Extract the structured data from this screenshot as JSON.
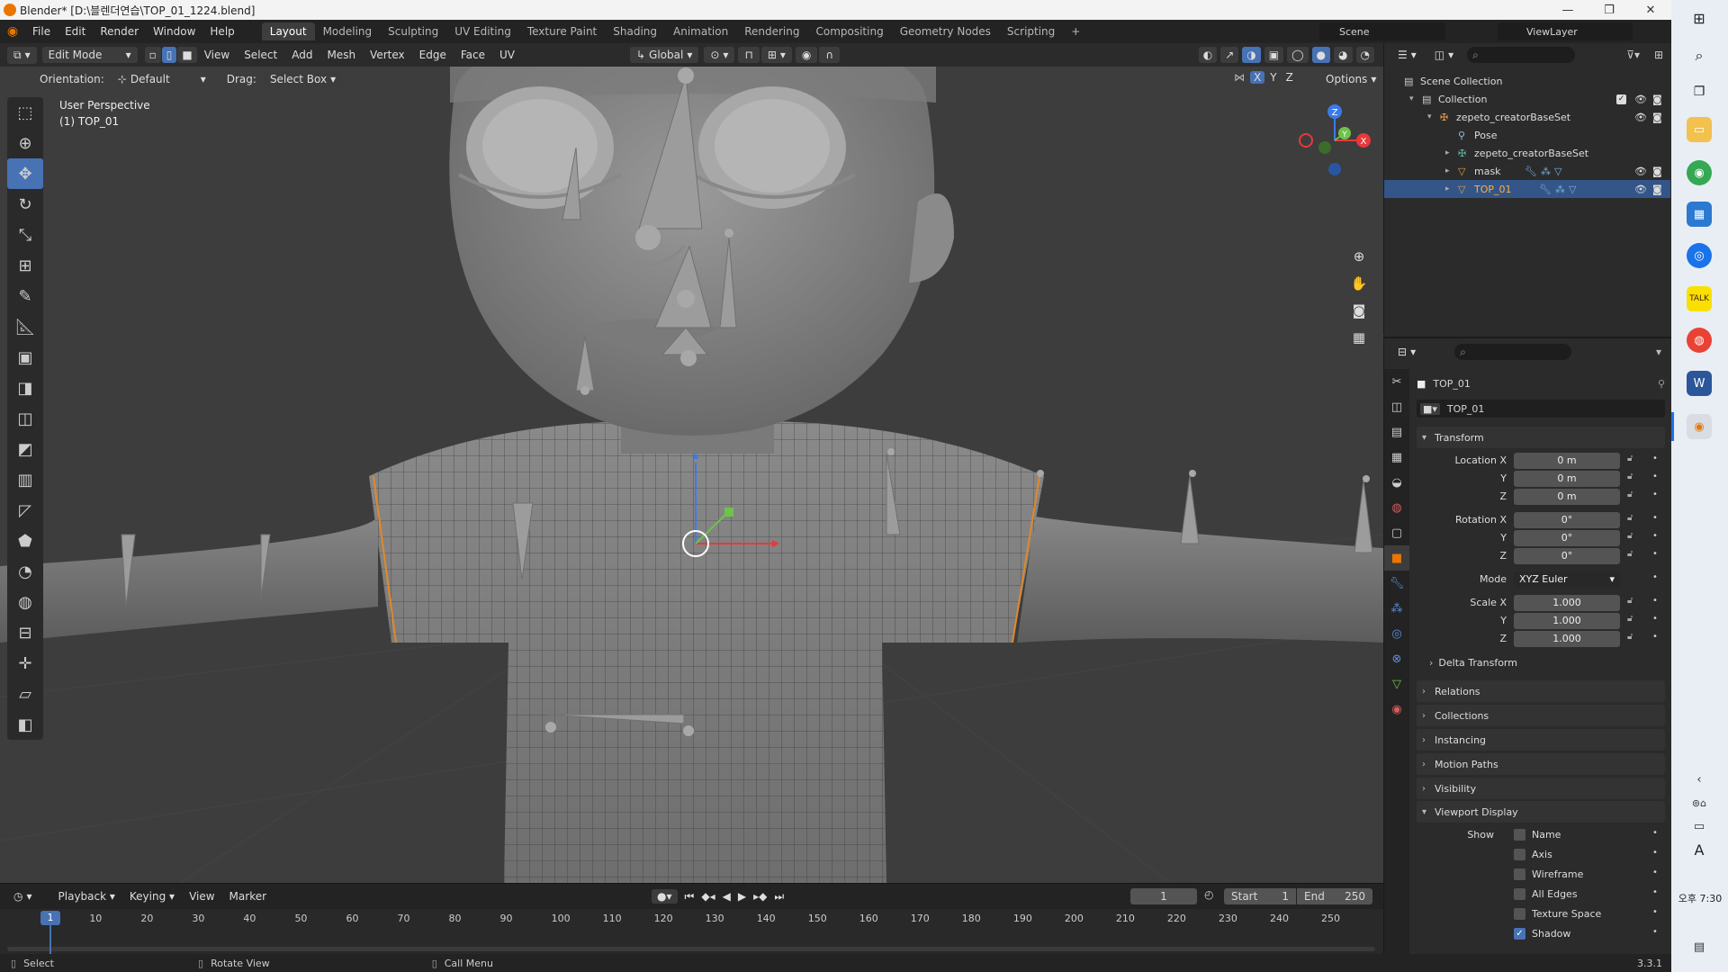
{
  "window": {
    "title": "Blender* [D:\\블렌더연습\\TOP_01_1224.blend]",
    "minimize": "—",
    "restore": "❐",
    "close": "✕"
  },
  "menu": [
    "File",
    "Edit",
    "Render",
    "Window",
    "Help"
  ],
  "workspaces": [
    "Layout",
    "Modeling",
    "Sculpting",
    "UV Editing",
    "Texture Paint",
    "Shading",
    "Animation",
    "Rendering",
    "Compositing",
    "Geometry Nodes",
    "Scripting"
  ],
  "active_workspace": "Layout",
  "add_workspace": "+",
  "scene": {
    "name": "Scene",
    "view_layer": "ViewLayer"
  },
  "viewport_header": {
    "mode": "Edit Mode",
    "menus": [
      "View",
      "Select",
      "Add",
      "Mesh",
      "Vertex",
      "Edge",
      "Face",
      "UV"
    ],
    "transform": "Global",
    "orientation_label": "Orientation:",
    "orientation_value": "Default",
    "drag_label": "Drag:",
    "drag_value": "Select Box",
    "axes": [
      "X",
      "Y",
      "Z"
    ],
    "options": "Options"
  },
  "viewport": {
    "perspective": "User Perspective",
    "object": "(1) TOP_01"
  },
  "toolbar_icons": [
    "select-box-icon",
    "cursor-icon",
    "move-icon",
    "rotate-icon",
    "scale-icon",
    "transform-icon",
    "annotate-icon",
    "measure-icon",
    "add-cube-icon",
    "extrude-icon",
    "inset-icon",
    "bevel-icon",
    "loop-cut-icon",
    "knife-icon",
    "poly-build-icon",
    "spin-icon",
    "smooth-icon",
    "edge-slide-icon",
    "shrink-fatten-icon",
    "shear-icon",
    "rip-icon"
  ],
  "active_tool_index": 2,
  "nav_gizmo": {
    "z": "Z",
    "y": "Y",
    "x": "X"
  },
  "outliner": {
    "rows": [
      {
        "label": "Scene Collection",
        "indent": 0
      },
      {
        "label": "Collection",
        "indent": 1
      },
      {
        "label": "zepeto_creatorBaseSet",
        "indent": 2
      },
      {
        "label": "Pose",
        "indent": 3
      },
      {
        "label": "zepeto_creatorBaseSet",
        "indent": 3
      },
      {
        "label": "mask",
        "indent": 3
      },
      {
        "label": "TOP_01",
        "indent": 3
      }
    ]
  },
  "properties": {
    "object_name": "TOP_01",
    "datablock": "TOP_01",
    "transform_title": "Transform",
    "location": {
      "label": "Location X",
      "x": "0 m",
      "y": "0 m",
      "z": "0 m"
    },
    "rotation": {
      "label": "Rotation X",
      "x": "0°",
      "y": "0°",
      "z": "0°"
    },
    "mode_label": "Mode",
    "mode_value": "XYZ Euler",
    "scale": {
      "label": "Scale X",
      "x": "1.000",
      "y": "1.000",
      "z": "1.000"
    },
    "axis_y": "Y",
    "axis_z": "Z",
    "delta": "Delta Transform",
    "panels": [
      "Relations",
      "Collections",
      "Instancing",
      "Motion Paths",
      "Visibility"
    ],
    "viewport_display": "Viewport Display",
    "show_label": "Show",
    "show_items": [
      {
        "label": "Name",
        "checked": false
      },
      {
        "label": "Axis",
        "checked": false
      },
      {
        "label": "Wireframe",
        "checked": false
      },
      {
        "label": "All Edges",
        "checked": false
      },
      {
        "label": "Texture Space",
        "checked": false
      },
      {
        "label": "Shadow",
        "checked": true
      }
    ]
  },
  "timeline": {
    "menus": [
      "Playback",
      "Keying",
      "View",
      "Marker"
    ],
    "current_frame": "1",
    "start_label": "Start",
    "start": "1",
    "end_label": "End",
    "end": "250",
    "ticks": [
      "1",
      "10",
      "20",
      "30",
      "40",
      "50",
      "60",
      "70",
      "80",
      "90",
      "100",
      "110",
      "120",
      "130",
      "140",
      "150",
      "160",
      "170",
      "180",
      "190",
      "200",
      "210",
      "220",
      "230",
      "240",
      "250"
    ]
  },
  "statusbar": {
    "select": "Select",
    "rotate": "Rotate View",
    "call_menu": "Call Menu",
    "version": "3.3.1"
  },
  "taskbar": {
    "time": "오후 7:30",
    "ime": "A"
  },
  "colors": {
    "accent": "#4772b3",
    "blender_orange": "#ea7600",
    "selection_row": "#335588"
  }
}
